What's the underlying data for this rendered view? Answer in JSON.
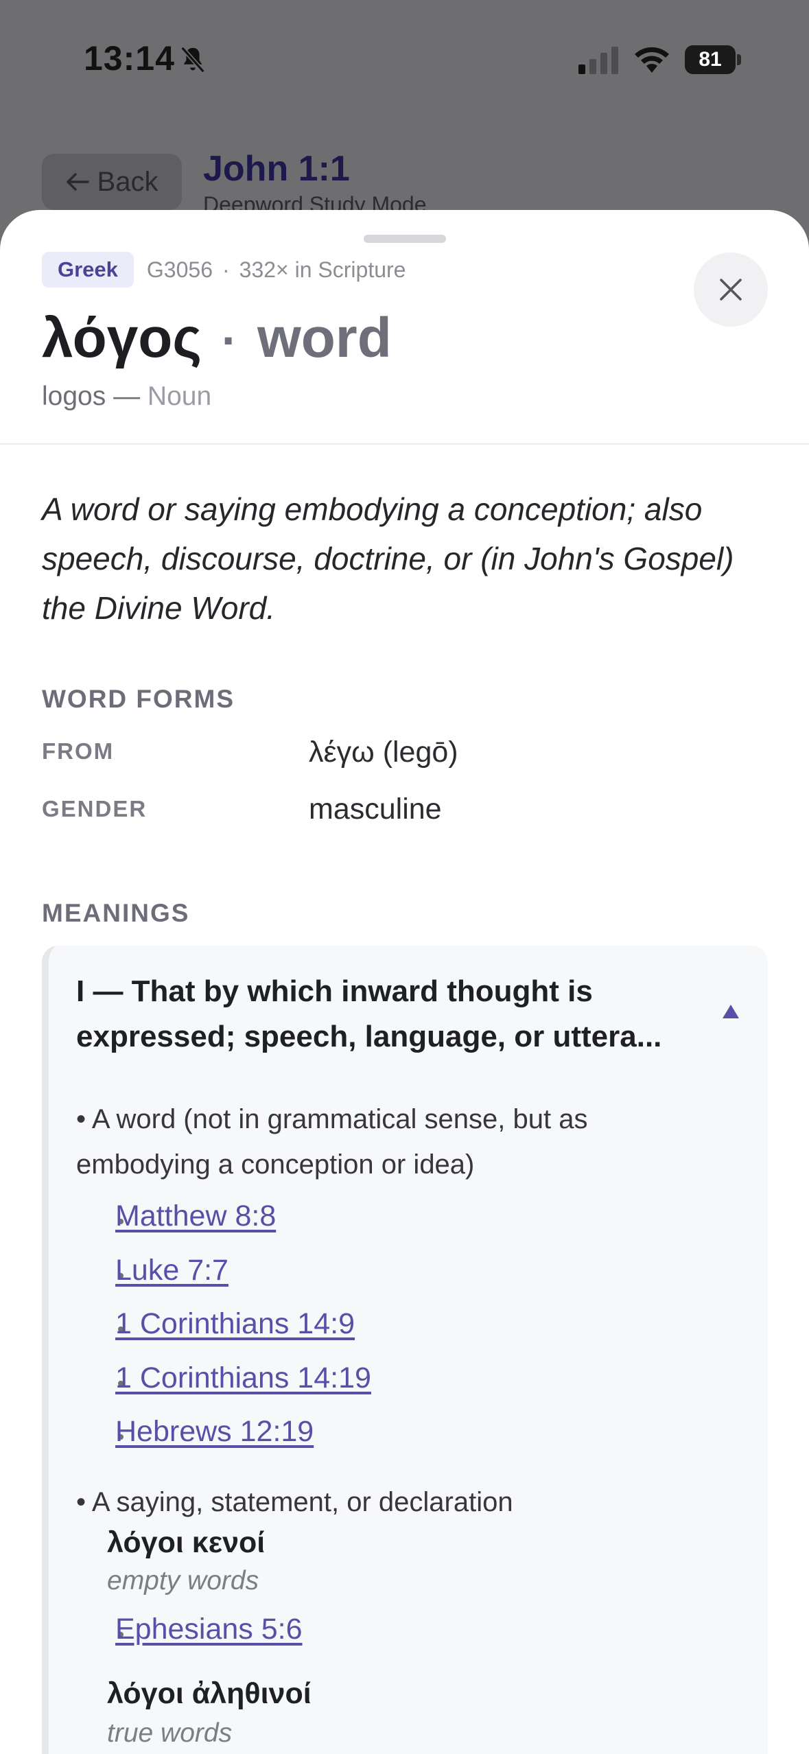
{
  "status_bar": {
    "time": "13:14",
    "battery": "81",
    "icons": [
      "bell-muted-icon",
      "signal-icon",
      "wifi-icon",
      "battery-icon"
    ]
  },
  "background_page": {
    "back_label": "Back",
    "title": "John 1:1",
    "subtitle": "Deepword Study Mode"
  },
  "entry": {
    "language": "Greek",
    "strongs": "G3056",
    "occurrences": "332× in Scripture",
    "lemma": "λόγος",
    "separator": "·",
    "gloss": "word",
    "transliteration": "logos —",
    "part_of_speech": "Noun",
    "definition": "A word or saying embodying a conception; also speech, discourse, doctrine, or (in John's Gospel) the Divine Word."
  },
  "word_forms": {
    "label": "WORD FORMS",
    "rows": [
      {
        "key": "FROM",
        "value": "λέγω (legō)"
      },
      {
        "key": "GENDER",
        "value": "masculine"
      }
    ]
  },
  "meanings": {
    "label": "MEANINGS",
    "sections": [
      {
        "heading": "I — That by which inward thought is expressed; speech, language, or uttera...",
        "expanded": true,
        "senses": [
          {
            "text": "• A word (not in grammatical sense, but as embodying a conception or idea)",
            "refs": [
              "Matthew 8:8",
              "Luke 7:7",
              "1 Corinthians 14:9",
              "1 Corinthians 14:19",
              "Hebrews 12:19"
            ]
          },
          {
            "text": "• A saying, statement, or declaration",
            "phrases": [
              {
                "greek": "λόγοι κενοί",
                "gloss": "empty words",
                "refs": [
                  "Ephesians 5:6"
                ]
              },
              {
                "greek": "λόγοι ἀληθινοί",
                "gloss": "true words",
                "refs": []
              }
            ]
          }
        ]
      }
    ]
  },
  "colors": {
    "accent": "#5a4fa8",
    "badge_bg": "#ecebfa",
    "scrim": "#6e6e71"
  }
}
